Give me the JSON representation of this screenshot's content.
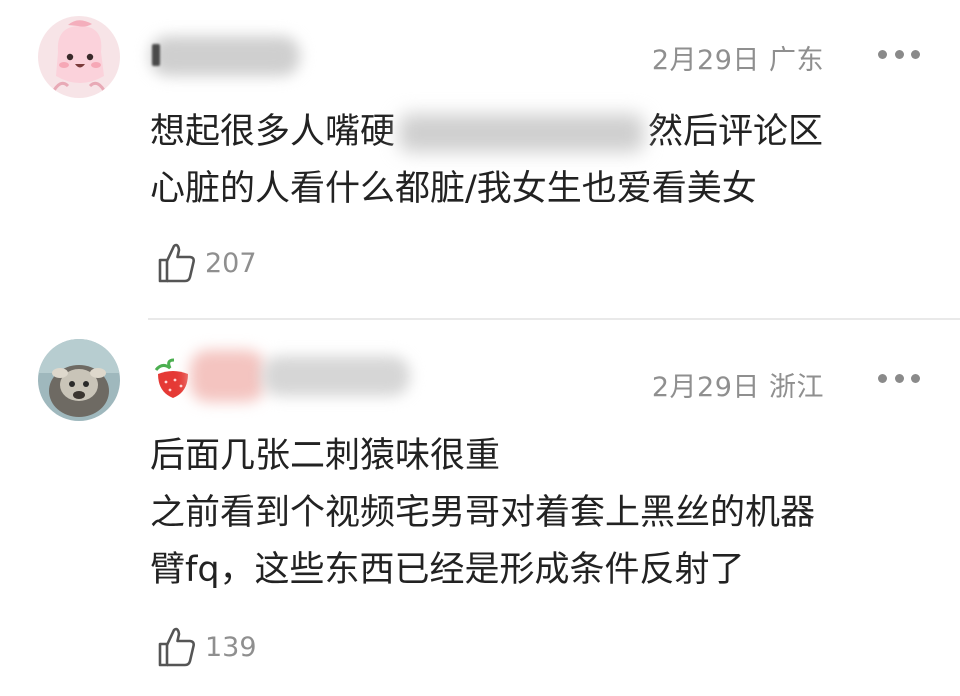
{
  "comments": [
    {
      "date": "2月29日",
      "location": "广东",
      "avatar": "pink-cartoon-avatar",
      "lines": [
        "想起很多人嘴硬",
        "然后评论区",
        "心脏的人看什么都脏/我女生也爱看美女"
      ],
      "likes": "207"
    },
    {
      "date": "2月29日",
      "location": "浙江",
      "avatar": "animal-photo-avatar",
      "lines": [
        "后面几张二刺猿味很重",
        "之前看到个视频宅男哥对着套上黑丝的机器",
        "臂fq，这些东西已经是形成条件反射了"
      ],
      "likes": "139"
    }
  ],
  "icons": {
    "like": "thumbs-up-icon",
    "more": "more-dots-icon"
  },
  "colors": {
    "meta": "#8f8f8f",
    "text": "#222222",
    "divider": "#e9e9e9"
  }
}
